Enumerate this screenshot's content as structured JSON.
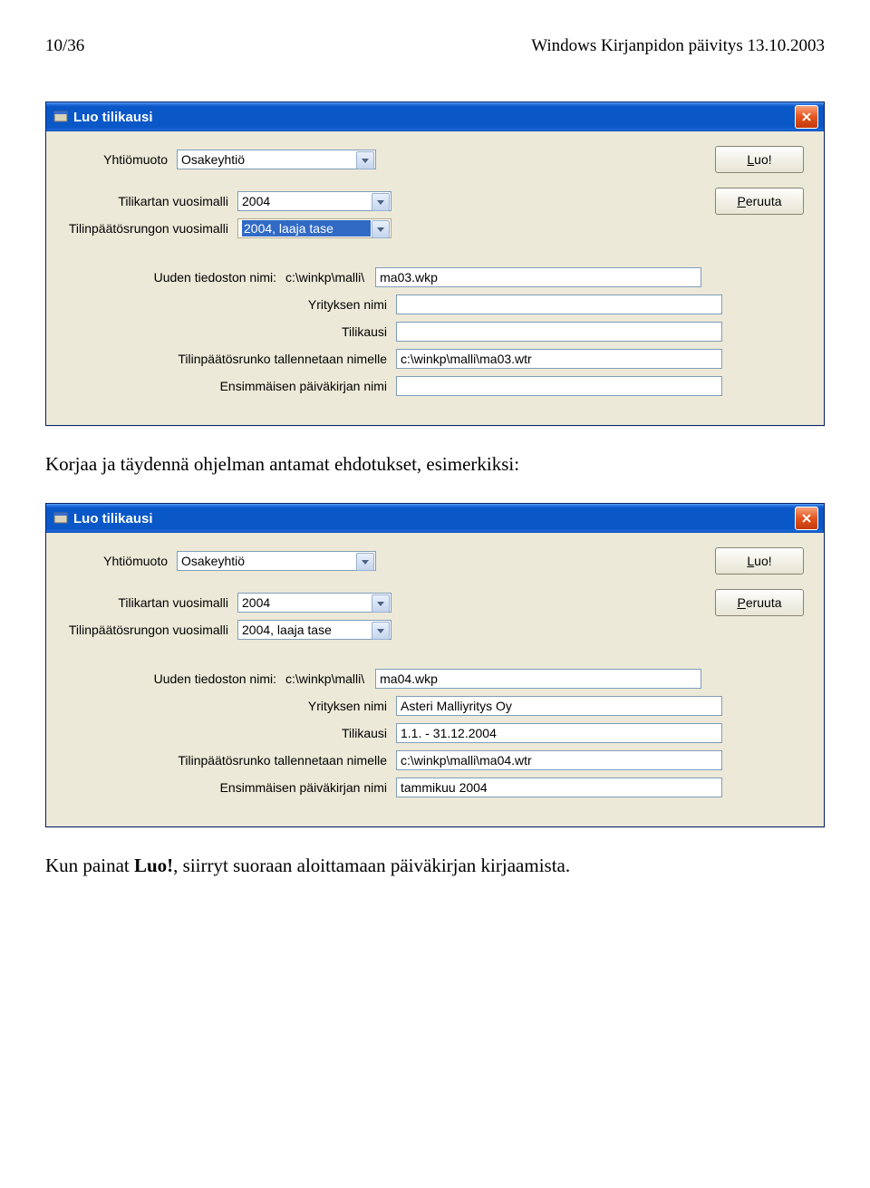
{
  "header": {
    "page": "10/36",
    "title": "Windows Kirjanpidon päivitys 13.10.2003"
  },
  "text1": "Korjaa ja täydennä ohjelman antamat ehdotukset, esimerkiksi:",
  "text2_a": "Kun painat ",
  "text2_b": "Luo!",
  "text2_c": ", siirryt suoraan aloittamaan päiväkirjan kirjaamista.",
  "win1": {
    "title": "Luo tilikausi",
    "labels": {
      "yhtiomuoto": "Yhtiömuoto",
      "tilikartta": "Tilikartan vuosimalli",
      "tilinpaatos": "Tilinpäätösrungon vuosimalli",
      "uusi": "Uuden tiedoston nimi:",
      "path": "c:\\winkp\\malli\\",
      "yritys": "Yrityksen nimi",
      "tilikausi": "Tilikausi",
      "runko": "Tilinpäätösrunko tallennetaan nimelle",
      "ens": "Ensimmäisen päiväkirjan nimi"
    },
    "values": {
      "yhtiomuoto": "Osakeyhtiö",
      "tilikartta": "2004",
      "tilinpaatos": "2004, laaja tase",
      "uusi": "ma03.wkp",
      "yritys": "",
      "tilikausi": "",
      "runko": "c:\\winkp\\malli\\ma03.wtr",
      "ens": ""
    },
    "buttons": {
      "luo": "Luo!",
      "peruuta": "Peruuta"
    }
  },
  "win2": {
    "title": "Luo tilikausi",
    "labels": {
      "yhtiomuoto": "Yhtiömuoto",
      "tilikartta": "Tilikartan vuosimalli",
      "tilinpaatos": "Tilinpäätösrungon vuosimalli",
      "uusi": "Uuden tiedoston nimi:",
      "path": "c:\\winkp\\malli\\",
      "yritys": "Yrityksen nimi",
      "tilikausi": "Tilikausi",
      "runko": "Tilinpäätösrunko tallennetaan nimelle",
      "ens": "Ensimmäisen päiväkirjan nimi"
    },
    "values": {
      "yhtiomuoto": "Osakeyhtiö",
      "tilikartta": "2004",
      "tilinpaatos": "2004, laaja tase",
      "uusi": "ma04.wkp",
      "yritys": "Asteri Malliyritys Oy",
      "tilikausi": "1.1. - 31.12.2004",
      "runko": "c:\\winkp\\malli\\ma04.wtr",
      "ens": "tammikuu 2004"
    },
    "buttons": {
      "luo": "Luo!",
      "peruuta": "Peruuta"
    }
  }
}
